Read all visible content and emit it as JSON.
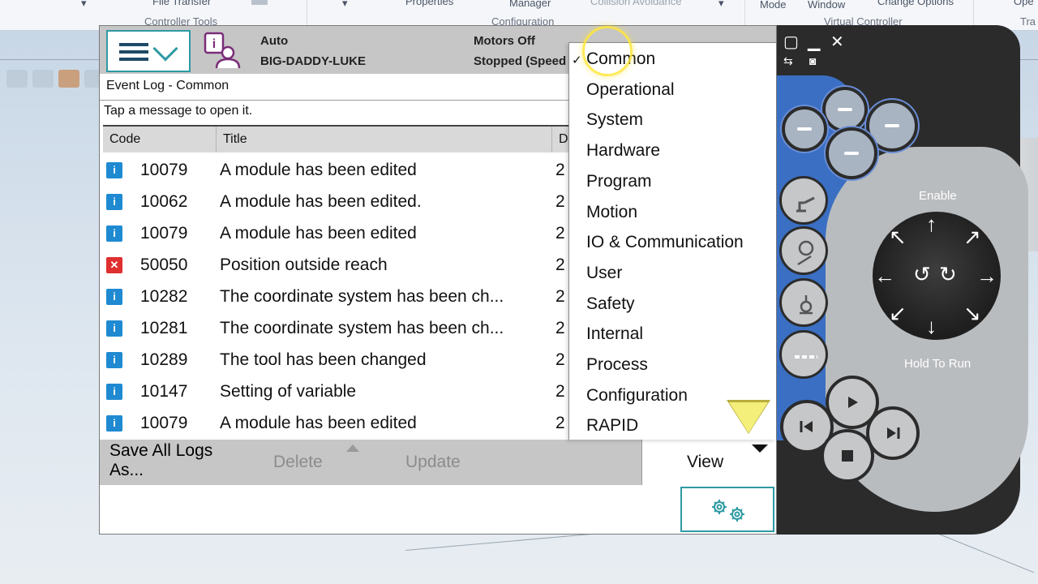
{
  "ribbon": {
    "file_transfer": "File Transfer",
    "controller_tools": "Controller Tools",
    "properties": "Properties",
    "manager": "Manager",
    "collision_avoidance": "Collision Avoidance",
    "configuration": "Configuration",
    "mode": "Mode",
    "window": "Window",
    "change_options": "Change Options",
    "virtual_controller": "Virtual Controller",
    "open_partial": "Ope",
    "tra_partial": "Tra"
  },
  "status": {
    "mode": "Auto",
    "controller_name": "BIG-DADDY-LUKE",
    "motors": "Motors Off",
    "state": "Stopped (Speed"
  },
  "view_title": "Event Log - Common",
  "tap_hint": "Tap a message to open it.",
  "table": {
    "headers": {
      "code": "Code",
      "title": "Title",
      "date": "D"
    },
    "rows": [
      {
        "type": "info",
        "code": "10079",
        "title": "A module has been edited",
        "date": "2"
      },
      {
        "type": "info",
        "code": "10062",
        "title": "A module has been edited.",
        "date": "2"
      },
      {
        "type": "info",
        "code": "10079",
        "title": "A module has been edited",
        "date": "2"
      },
      {
        "type": "error",
        "code": "50050",
        "title": "Position outside reach",
        "date": "2"
      },
      {
        "type": "info",
        "code": "10282",
        "title": "The coordinate system has been ch...",
        "date": "2"
      },
      {
        "type": "info",
        "code": "10281",
        "title": "The coordinate system has been ch...",
        "date": "2"
      },
      {
        "type": "info",
        "code": "10289",
        "title": "The tool has been changed",
        "date": "2"
      },
      {
        "type": "info",
        "code": "10147",
        "title": "Setting of variable",
        "date": "2"
      },
      {
        "type": "info",
        "code": "10079",
        "title": "A module has been edited",
        "date": "2"
      }
    ]
  },
  "dropdown": {
    "selected": "Common",
    "items": [
      "Common",
      "Operational",
      "System",
      "Hardware",
      "Program",
      "Motion",
      "IO & Communication",
      "User",
      "Safety",
      "Internal",
      "Process",
      "Configuration",
      "RAPID"
    ]
  },
  "commands": {
    "save_all_line1": "Save All Logs",
    "save_all_line2": "As...",
    "delete": "Delete",
    "update": "Update",
    "view": "View"
  },
  "hardware": {
    "enable": "Enable",
    "hold_to_run": "Hold To Run"
  },
  "icons": {
    "info": "i",
    "error": "✕",
    "checkmark": "✓"
  },
  "colors": {
    "accent": "#2e9aa3",
    "info": "#1f8ad1",
    "error": "#e02f2f",
    "panel_blue": "#3a6fc3"
  }
}
